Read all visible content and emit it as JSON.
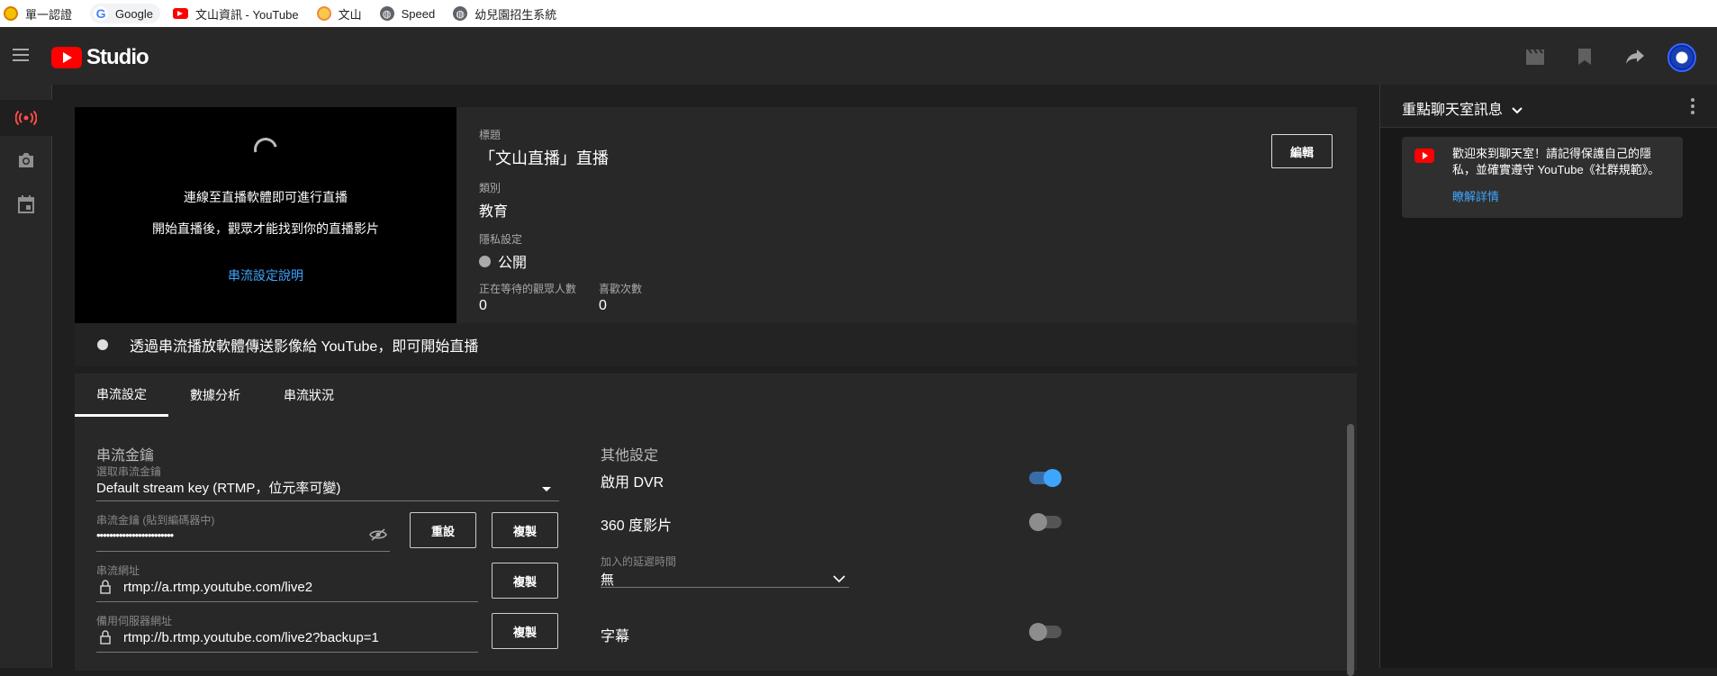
{
  "bookmarks": [
    {
      "label": "單一認證",
      "icon": "auth-icon"
    },
    {
      "label": "Google",
      "icon": "google-icon"
    },
    {
      "label": "文山資訊 - YouTube",
      "icon": "youtube-icon"
    },
    {
      "label": "文山",
      "icon": "face-icon"
    },
    {
      "label": "Speed",
      "icon": "globe-icon"
    },
    {
      "label": "幼兒園招生系統",
      "icon": "globe-icon"
    }
  ],
  "header": {
    "logo_text": "Studio"
  },
  "preview": {
    "line1": "連線至直播軟體即可進行直播",
    "line2": "開始直播後，觀眾才能找到你的直播影片",
    "link": "串流設定說明"
  },
  "meta": {
    "title_label": "標題",
    "title": "「文山直播」直播",
    "category_label": "類別",
    "category": "教育",
    "privacy_label": "隱私設定",
    "privacy": "公開",
    "waiting_label": "正在等待的觀眾人數",
    "waiting": "0",
    "likes_label": "喜歡次數",
    "likes": "0",
    "edit_button": "編輯"
  },
  "status": {
    "text": "透過串流播放軟體傳送影像給 YouTube，即可開始直播"
  },
  "tabs": [
    "串流設定",
    "數據分析",
    "串流狀況"
  ],
  "stream": {
    "section_title": "串流金鑰",
    "select_label": "選取串流金鑰",
    "select_value": "Default stream key (RTMP，位元率可變)",
    "key_label": "串流金鑰 (貼到編碼器中)",
    "key_value": "••••••••••••••••••••••••",
    "reset_button": "重設",
    "copy_button": "複製",
    "url_label": "串流網址",
    "url_value": "rtmp://a.rtmp.youtube.com/live2",
    "backup_label": "備用伺服器網址",
    "backup_value": "rtmp://b.rtmp.youtube.com/live2?backup=1"
  },
  "other": {
    "section_title": "其他設定",
    "dvr_label": "啟用 DVR",
    "dvr_on": true,
    "vr_label": "360 度影片",
    "vr_on": false,
    "latency_label": "加入的延遲時間",
    "latency_value": "無",
    "captions_label": "字幕",
    "captions_on": false
  },
  "chat": {
    "title": "重點聊天室訊息",
    "message": "歡迎來到聊天室！請記得保護自己的隱私，並確實遵守 YouTube《社群規範》。",
    "link": "瞭解詳情"
  },
  "colors": {
    "accent": "#3ea6ff",
    "brand": "#ff0000",
    "background": "#1f1f1f"
  }
}
